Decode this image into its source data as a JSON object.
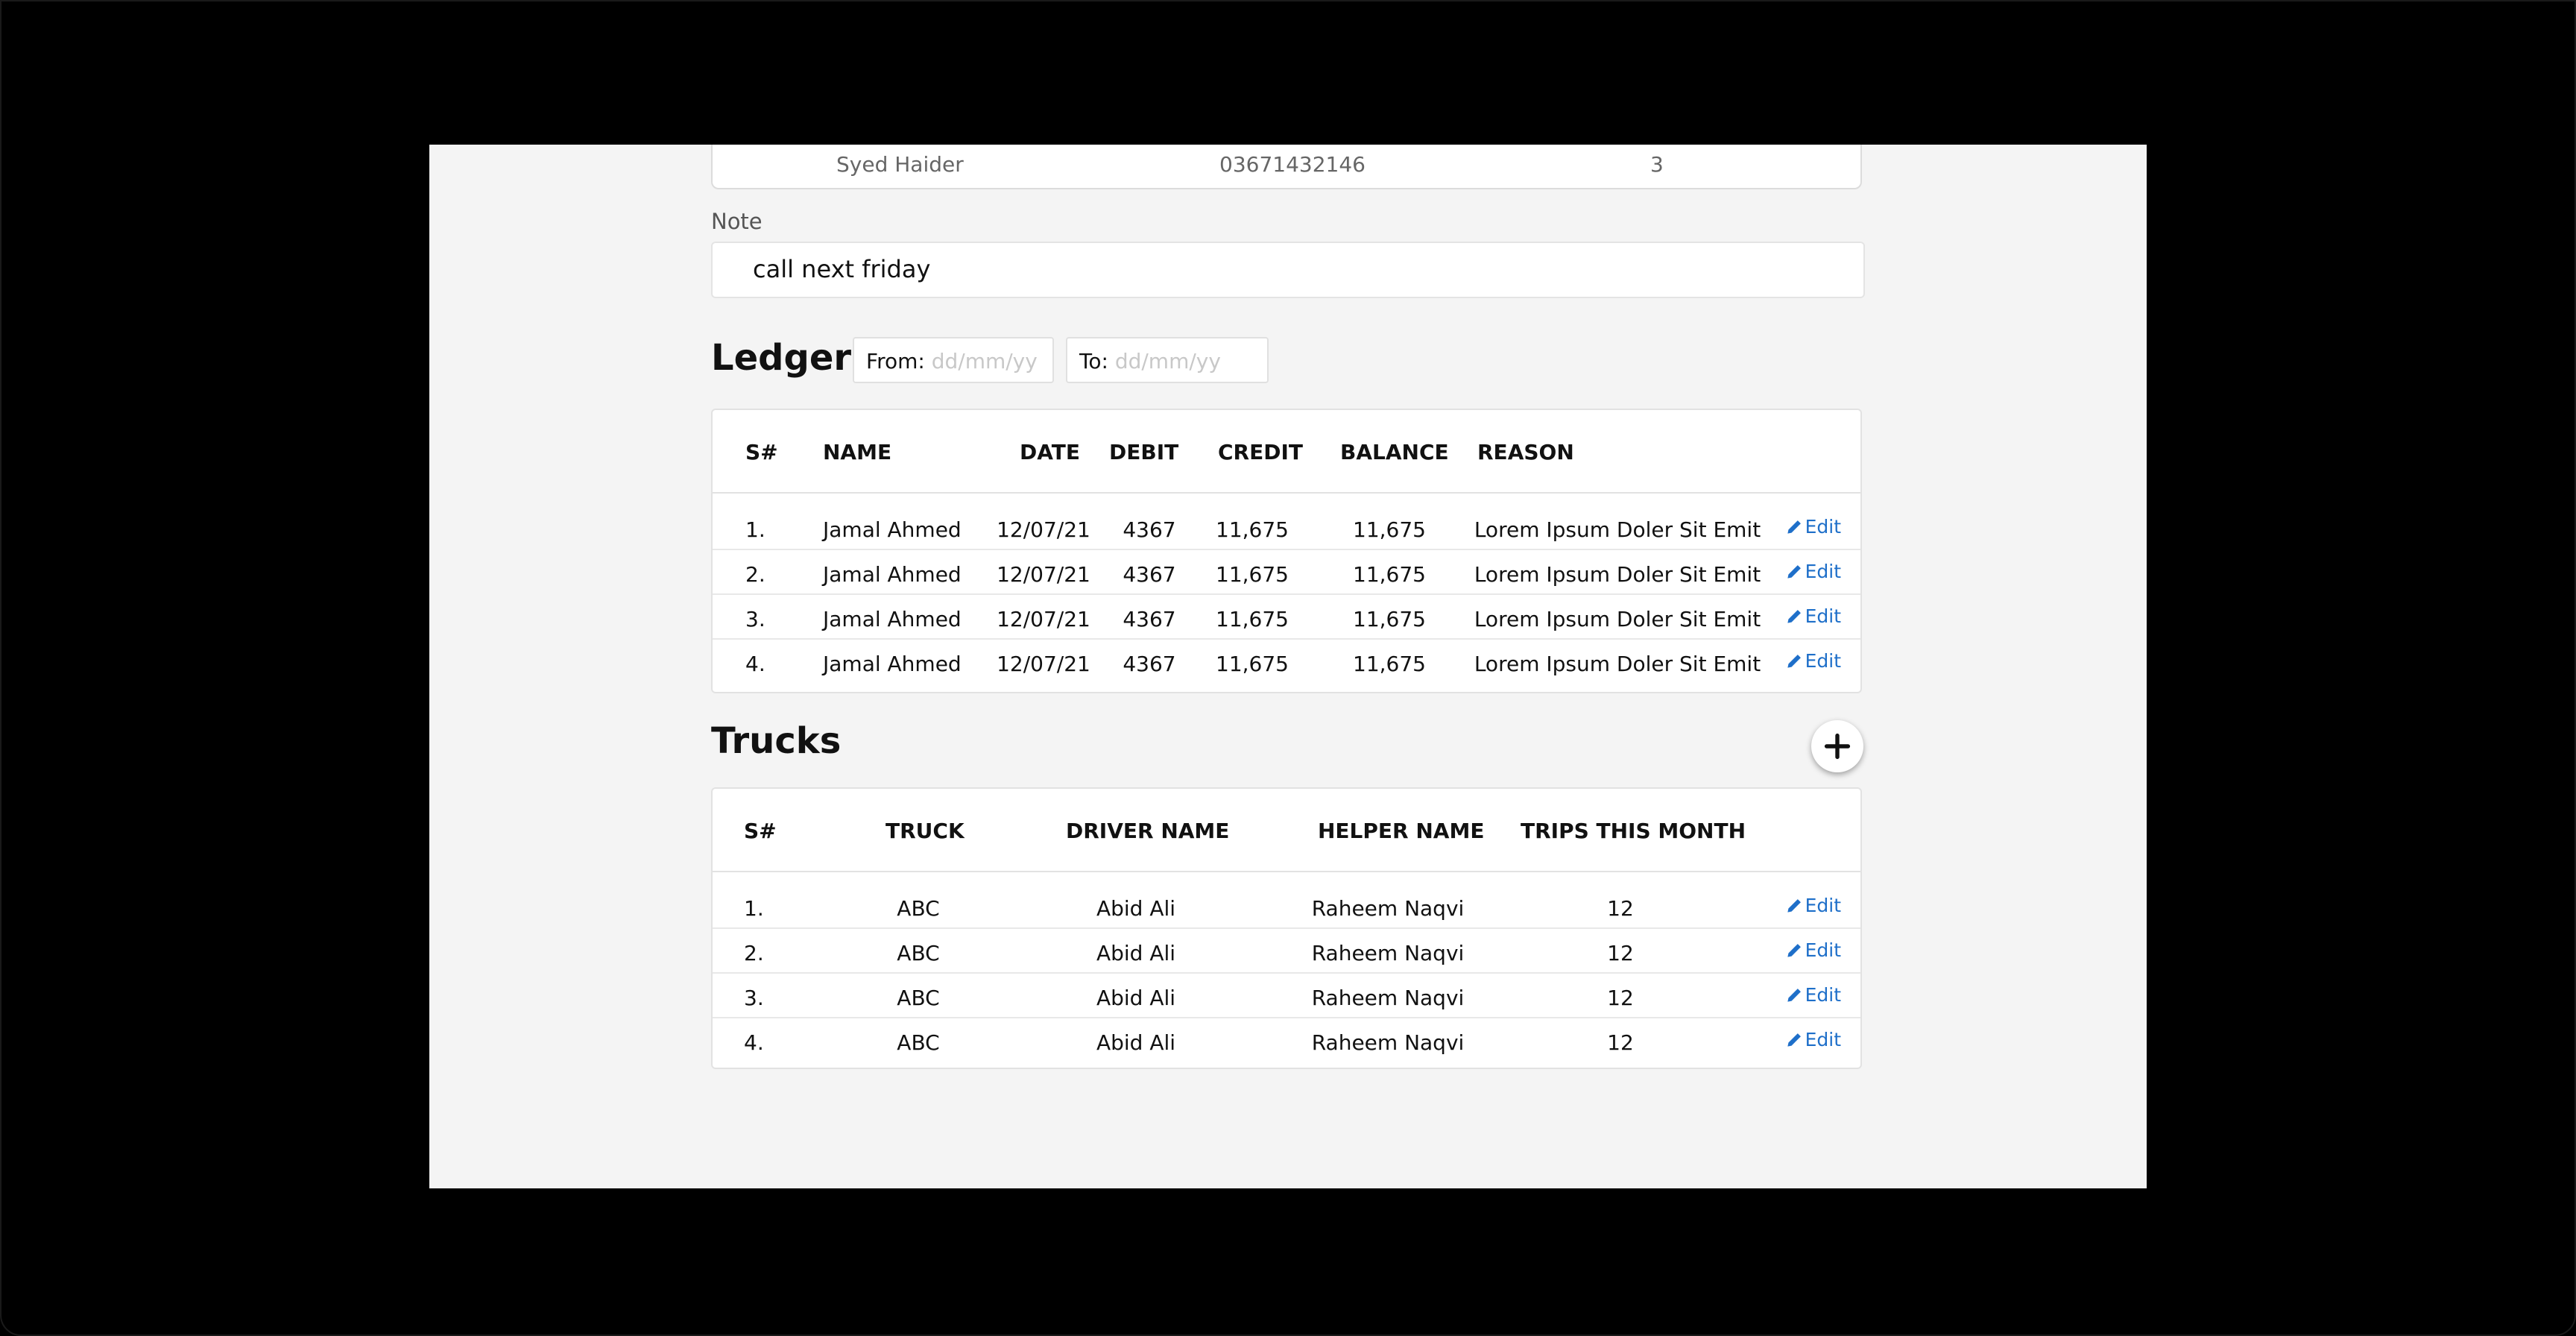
{
  "customer_row": {
    "name": "Syed Haider",
    "phone": "03671432146",
    "count": "3"
  },
  "note": {
    "label": "Note",
    "value": "call next friday"
  },
  "ledger": {
    "title": "Ledger",
    "from_label": "From:",
    "from_placeholder": "dd/mm/yy",
    "to_label": "To:",
    "to_placeholder": "dd/mm/yy",
    "columns": [
      "S#",
      "NAME",
      "DATE",
      "DEBIT",
      "CREDIT",
      "BALANCE",
      "REASON"
    ],
    "rows": [
      {
        "sn": "1.",
        "name": "Jamal Ahmed",
        "date": "12/07/21",
        "debit": "4367",
        "credit": "11,675",
        "balance": "11,675",
        "reason": "Lorem Ipsum Doler Sit Emit",
        "action": "Edit"
      },
      {
        "sn": "2.",
        "name": "Jamal Ahmed",
        "date": "12/07/21",
        "debit": "4367",
        "credit": "11,675",
        "balance": "11,675",
        "reason": "Lorem Ipsum Doler Sit Emit",
        "action": "Edit"
      },
      {
        "sn": "3.",
        "name": "Jamal Ahmed",
        "date": "12/07/21",
        "debit": "4367",
        "credit": "11,675",
        "balance": "11,675",
        "reason": "Lorem Ipsum Doler Sit Emit",
        "action": "Edit"
      },
      {
        "sn": "4.",
        "name": "Jamal Ahmed",
        "date": "12/07/21",
        "debit": "4367",
        "credit": "11,675",
        "balance": "11,675",
        "reason": "Lorem Ipsum Doler Sit Emit",
        "action": "Edit"
      }
    ]
  },
  "trucks": {
    "title": "Trucks",
    "add_icon": "plus-icon",
    "columns": [
      "S#",
      "TRUCK",
      "DRIVER NAME",
      "HELPER NAME",
      "TRIPS THIS MONTH"
    ],
    "rows": [
      {
        "sn": "1.",
        "truck": "ABC",
        "driver": "Abid Ali",
        "helper": "Raheem Naqvi",
        "trips": "12",
        "action": "Edit"
      },
      {
        "sn": "2.",
        "truck": "ABC",
        "driver": "Abid Ali",
        "helper": "Raheem Naqvi",
        "trips": "12",
        "action": "Edit"
      },
      {
        "sn": "3.",
        "truck": "ABC",
        "driver": "Abid Ali",
        "helper": "Raheem Naqvi",
        "trips": "12",
        "action": "Edit"
      },
      {
        "sn": "4.",
        "truck": "ABC",
        "driver": "Abid Ali",
        "helper": "Raheem Naqvi",
        "trips": "12",
        "action": "Edit"
      }
    ]
  },
  "colors": {
    "accent": "#1e6fc9",
    "background": "#f4f4f4",
    "frame": "#000000"
  }
}
